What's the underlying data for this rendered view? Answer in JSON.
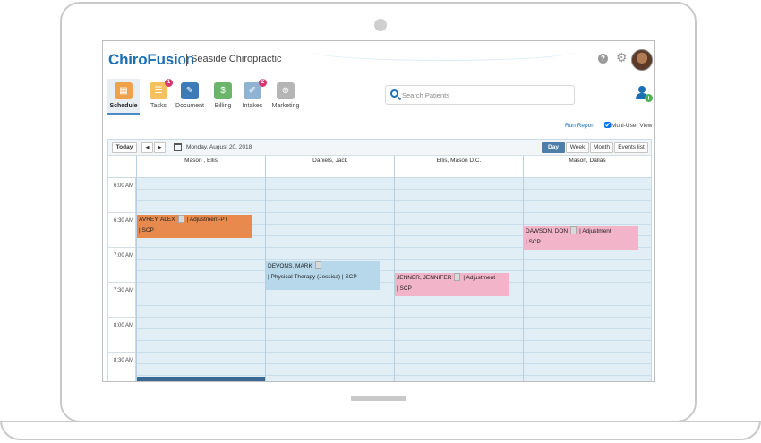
{
  "app": {
    "logo_part1": "ChiroFusi",
    "logo_part2": "on",
    "practice_name": "Seaside Chiropractic"
  },
  "header": {
    "help_symbol": "?",
    "settings_symbol": "⚙"
  },
  "nav": {
    "items": [
      {
        "label": "Schedule",
        "icon": "calendar-icon",
        "color": "#f0a24b",
        "glyph": "▦"
      },
      {
        "label": "Tasks",
        "icon": "tasks-icon",
        "color": "#f4c15c",
        "glyph": "☰",
        "badge": "1"
      },
      {
        "label": "Document",
        "icon": "document-icon",
        "color": "#3d7ab8",
        "glyph": "✎"
      },
      {
        "label": "Billing",
        "icon": "billing-icon",
        "color": "#6bb56b",
        "glyph": "$"
      },
      {
        "label": "Intakes",
        "icon": "intakes-icon",
        "color": "#8fb3d3",
        "glyph": "✐",
        "badge": "2"
      },
      {
        "label": "Marketing",
        "icon": "marketing-icon",
        "color": "#b5b5b5",
        "glyph": "⊕"
      }
    ]
  },
  "search": {
    "placeholder": "Search Patients"
  },
  "toolbar": {
    "run_report": "Run Report",
    "multi_user": "Multi-User View"
  },
  "calendar": {
    "today": "Today",
    "prev": "◀",
    "next": "▶",
    "date": "Monday, August 20, 2018",
    "views": [
      "Day",
      "Week",
      "Month",
      "Events list"
    ],
    "active_view": "Day",
    "columns": [
      "Mason , Ellis",
      "Daniels, Jack",
      "Ellis, Mason D.C.",
      "Mason, Dallas"
    ],
    "times": [
      "6:00 AM",
      "6:30 AM",
      "7:00 AM",
      "7:30 AM",
      "8:00 AM",
      "8:30 AM"
    ],
    "events": [
      {
        "line1": "AVREY, ALEX",
        "line1_rest": "|  Adjustment-PT",
        "line2": "|  SCP",
        "color": "#e88a4d"
      },
      {
        "line1": "DEVONS, MARK",
        "line1_rest": "",
        "line2": "|  Physical Therapy (Jessica)  |  SCP",
        "color": "#b7d8ea"
      },
      {
        "line1": "JENNER, JENNIFER",
        "line1_rest": "|  Adjustment",
        "line2": "|  SCP",
        "color": "#f2b4c9"
      },
      {
        "line1": "DAWSON, DON",
        "line1_rest": "|  Adjustment",
        "line2": "|  SCP",
        "color": "#f2b4c9"
      }
    ]
  }
}
